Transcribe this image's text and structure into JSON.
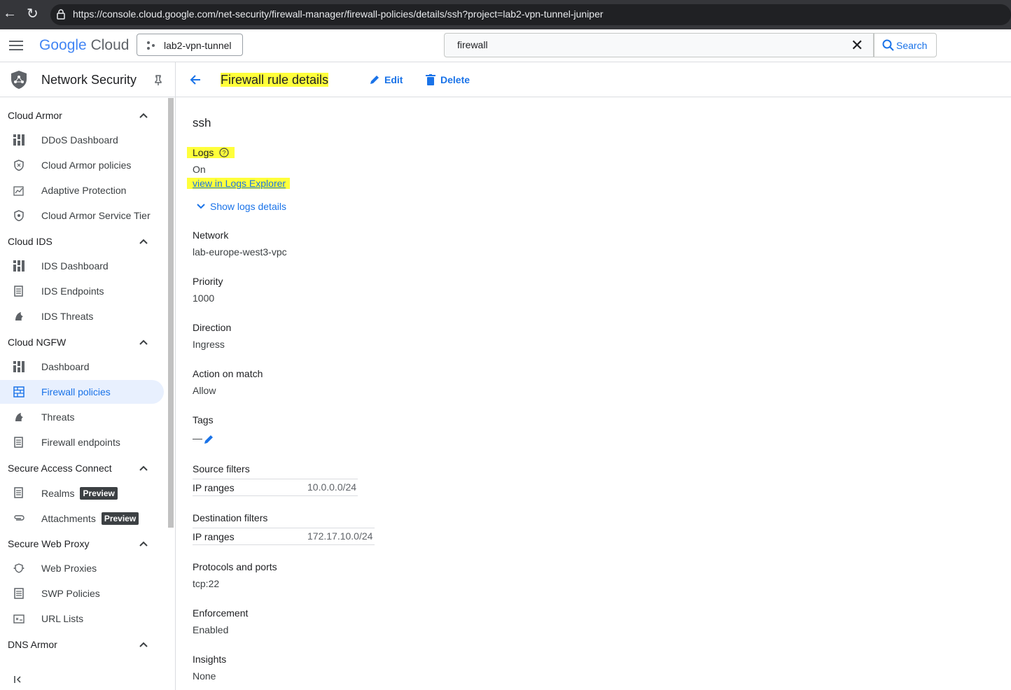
{
  "browser": {
    "url": "https://console.cloud.google.com/net-security/firewall-manager/firewall-policies/details/ssh?project=lab2-vpn-tunnel-juniper"
  },
  "header": {
    "logo_google": "Google",
    "logo_cloud": "Cloud",
    "project": "lab2-vpn-tunnel",
    "search_value": "firewall",
    "search_label": "Search"
  },
  "sidebar": {
    "title": "Network Security",
    "sections": [
      {
        "title": "Cloud Armor",
        "items": [
          "DDoS Dashboard",
          "Cloud Armor policies",
          "Adaptive Protection",
          "Cloud Armor Service Tier"
        ]
      },
      {
        "title": "Cloud IDS",
        "items": [
          "IDS Dashboard",
          "IDS Endpoints",
          "IDS Threats"
        ]
      },
      {
        "title": "Cloud NGFW",
        "items": [
          "Dashboard",
          "Firewall policies",
          "Threats",
          "Firewall endpoints"
        ]
      },
      {
        "title": "Secure Access Connect",
        "items": [
          "Realms",
          "Attachments"
        ],
        "badge": "Preview"
      },
      {
        "title": "Secure Web Proxy",
        "items": [
          "Web Proxies",
          "SWP Policies",
          "URL Lists"
        ]
      },
      {
        "title": "DNS Armor",
        "items": []
      }
    ],
    "active_item": "Firewall policies"
  },
  "toolbar": {
    "title": "Firewall rule details",
    "edit": "Edit",
    "delete": "Delete"
  },
  "details": {
    "name": "ssh",
    "logs_label": "Logs",
    "logs_value": "On",
    "logs_link": "view in Logs Explorer",
    "show_logs": "Show logs details",
    "network_label": "Network",
    "network_value": "lab-europe-west3-vpc",
    "priority_label": "Priority",
    "priority_value": "1000",
    "direction_label": "Direction",
    "direction_value": "Ingress",
    "action_label": "Action on match",
    "action_value": "Allow",
    "tags_label": "Tags",
    "tags_value": "—",
    "source_label": "Source filters",
    "source_key": "IP ranges",
    "source_value": "10.0.0.0/24",
    "dest_label": "Destination filters",
    "dest_key": "IP ranges",
    "dest_value": "172.17.10.0/24",
    "protocols_label": "Protocols and ports",
    "protocols_value": "tcp:22",
    "enforcement_label": "Enforcement",
    "enforcement_value": "Enabled",
    "insights_label": "Insights",
    "insights_value": "None"
  },
  "colors": {
    "highlight": "#ffff3b",
    "link": "#1a73e8",
    "active_bg": "#e8f0fe"
  }
}
